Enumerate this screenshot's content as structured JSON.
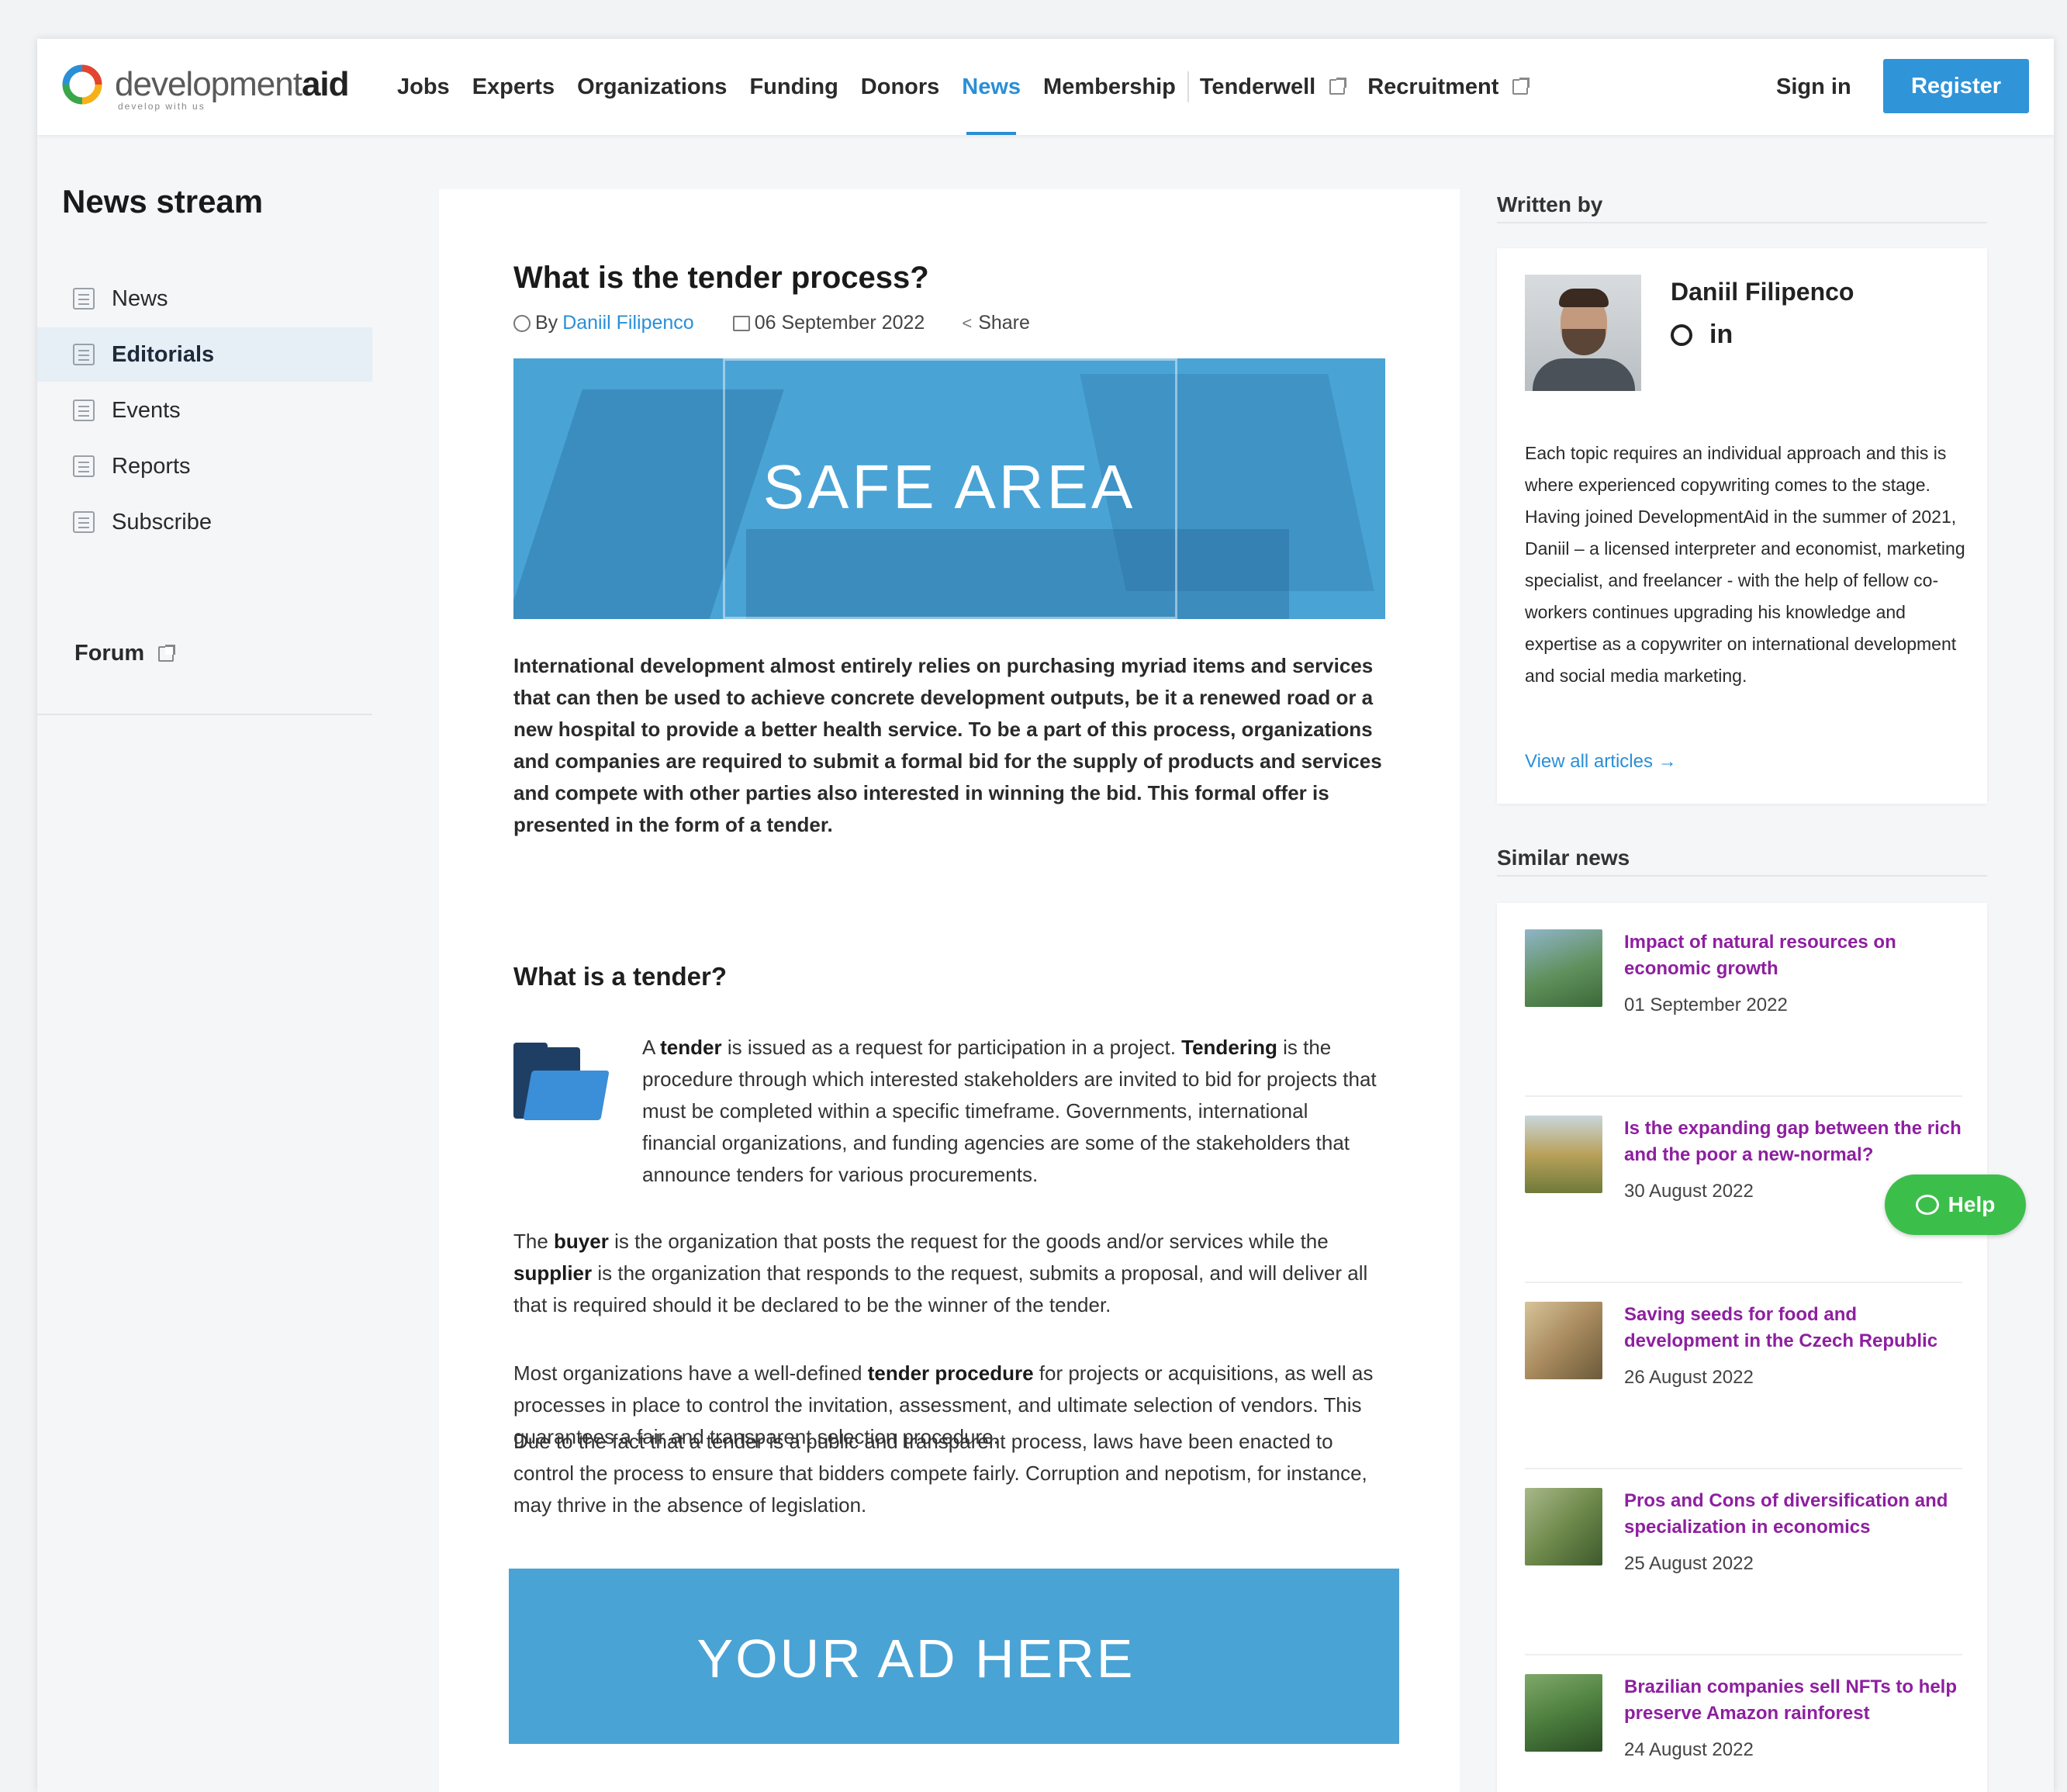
{
  "header": {
    "logo_text_light": "development",
    "logo_text_bold": "aid",
    "logo_tagline": "develop with us",
    "nav": [
      "Jobs",
      "Experts",
      "Organizations",
      "Funding",
      "Donors",
      "News",
      "Membership"
    ],
    "nav_active": "News",
    "nav_external": [
      "Tenderwell",
      "Recruitment"
    ],
    "signin_label": "Sign in",
    "register_label": "Register"
  },
  "sidebar": {
    "title": "News stream",
    "items": [
      {
        "label": "News",
        "icon": "newspaper-icon"
      },
      {
        "label": "Editorials",
        "icon": "edit-icon",
        "active": true
      },
      {
        "label": "Events",
        "icon": "ticket-icon"
      },
      {
        "label": "Reports",
        "icon": "report-icon"
      },
      {
        "label": "Subscribe",
        "icon": "envelope-icon"
      }
    ],
    "forum_label": "Forum"
  },
  "article": {
    "title": "What is the tender process?",
    "by_label": "By",
    "author": "Daniil Filipenco",
    "date": "06 September 2022",
    "share_label": "Share",
    "hero_text": "SAFE AREA",
    "lead": "International development almost entirely relies on purchasing myriad items and services that can then be used to achieve concrete development outputs, be it a renewed road or a new hospital to provide a better health service. To be a part of this process, organizations and companies are required to submit a formal bid for the supply of products and services and compete with other parties also interested in winning the bid. This formal offer is presented in the form of a tender.",
    "h2": "What is a tender?",
    "p1_a": "A ",
    "p1_b1": "tender",
    "p1_c": " is issued as a request for participation in a project. ",
    "p1_b2": "Tendering",
    "p1_d": " is the procedure through which interested stakeholders are invited to bid for projects that must be completed within a specific timeframe. Governments, international financial organizations, and funding agencies are some of the stakeholders that announce tenders for various procurements.",
    "p2_a": "The ",
    "p2_b1": "buyer",
    "p2_c": " is the organization that posts the request for the goods and/or services while the ",
    "p2_b2": "supplier",
    "p2_d": " is the organization that responds to the request, submits a proposal, and will deliver all that is required should it be declared to be the winner of the tender.",
    "p3_a": "Most organizations have a well-defined ",
    "p3_b": "tender procedure",
    "p3_c": " for projects or acquisitions, as well as processes in place to control the invitation, assessment, and ultimate selection of vendors. This guarantees a fair and transparent selection procedure.",
    "p4": "Due to the fact that a tender is a public and transparent process, laws have been enacted to control the process to ensure that bidders compete fairly. Corruption and nepotism, for instance, may thrive in the absence of legislation.",
    "ad_text": "YOUR AD HERE"
  },
  "written_by": {
    "label": "Written by",
    "name": "Daniil Filipenco",
    "linkedin_label": "in",
    "bio": "Each topic requires an individual approach and this is where experienced copywriting comes to the stage. Having joined DevelopmentAid in the summer of 2021, Daniil – a licensed interpreter and economist, marketing specialist, and freelancer - with the help of fellow co-workers continues upgrading his knowledge and expertise as a copywriter on international development and social media marketing.",
    "view_all": "View all articles →"
  },
  "similar_news": {
    "label": "Similar news",
    "items": [
      {
        "title": "Impact of natural resources on economic growth",
        "date": "01 September 2022",
        "color": "#5f8f5a"
      },
      {
        "title": "Is the expanding gap between the rich and the poor a new-normal?",
        "date": "30 August 2022",
        "color": "#b9a15a"
      },
      {
        "title": "Saving seeds for food and development in the Czech Republic",
        "date": "26 August 2022",
        "color": "#a88a5e"
      },
      {
        "title": "Pros and Cons of diversification and specialization in economics",
        "date": "25 August 2022",
        "color": "#6f8a4c"
      },
      {
        "title": "Brazilian companies sell NFTs to help preserve Amazon rainforest",
        "date": "24 August 2022",
        "color": "#4d7f3f"
      }
    ]
  },
  "help_label": "Help",
  "colors": {
    "accent": "#2f94d8",
    "link_purple": "#8e1fa0",
    "help_green": "#3cbf4a",
    "ad_blue": "#4aa3d5"
  }
}
